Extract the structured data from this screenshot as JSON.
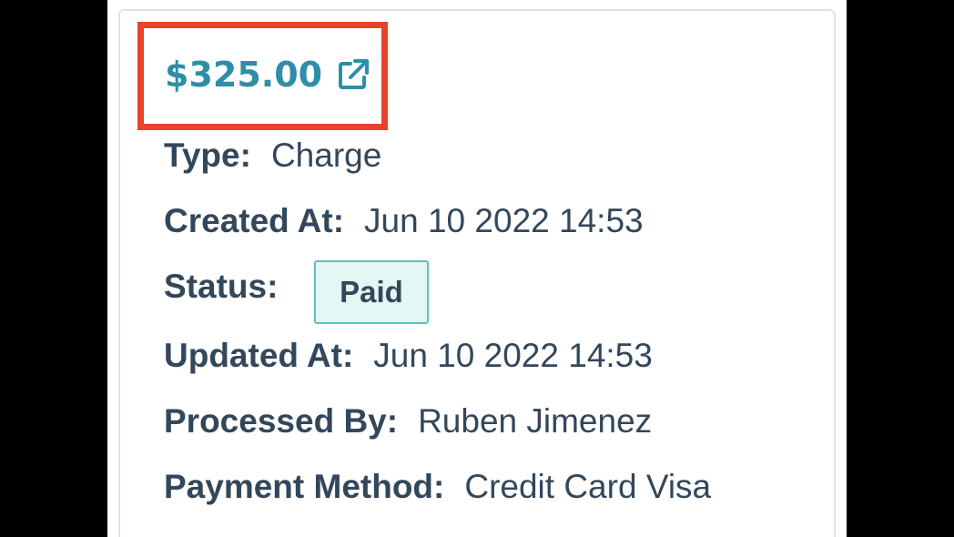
{
  "payment": {
    "amount": "$325.00",
    "amount_icon": "external-link-icon",
    "fields": {
      "type_label": "Type:",
      "type_value": "Charge",
      "created_label": "Created At:",
      "created_value": "Jun 10 2022 14:53",
      "status_label": "Status:",
      "status_value": "Paid",
      "updated_label": "Updated At:",
      "updated_value": "Jun 10 2022 14:53",
      "processed_label": "Processed By:",
      "processed_value": "Ruben Jimenez",
      "method_label": "Payment Method:",
      "method_value": "Credit Card Visa"
    }
  },
  "colors": {
    "link": "#2e8ea8",
    "text": "#33475b",
    "highlight": "#e8412c",
    "status_border": "#5fc2b6",
    "status_bg": "#e5f7f5"
  }
}
